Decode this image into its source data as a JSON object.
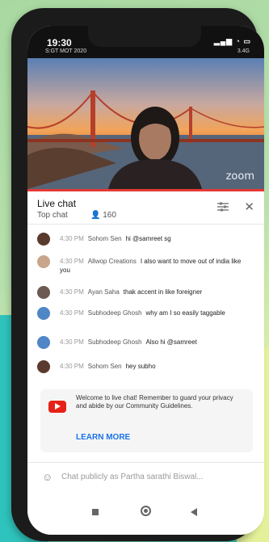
{
  "status_bar": {
    "time": "19:30",
    "sub_left": "S:GT MOT 2020",
    "sub_right": "3.4G"
  },
  "video": {
    "watermark": "zoom"
  },
  "chat_header": {
    "title": "Live chat",
    "mode": "Top chat",
    "viewer_count": "160"
  },
  "messages": [
    {
      "time": "4:30 PM",
      "name": "Sohom Sen",
      "text": "hi @samreet sg",
      "avatar_color": "#5a3a2e"
    },
    {
      "time": "4:30 PM",
      "name": "Allwop Creations",
      "text": "I also want to move out of india like you",
      "avatar_color": "#c9a58c"
    },
    {
      "time": "4:30 PM",
      "name": "Ayan Saha",
      "text": "thak accent in like foreigner",
      "avatar_color": "#6d5a52"
    },
    {
      "time": "4:30 PM",
      "name": "Subhodeep Ghosh",
      "text": "why am I so easily taggable",
      "avatar_color": "#4f86c6"
    },
    {
      "time": "4:30 PM",
      "name": "Subhodeep Ghosh",
      "text": "Also hi @samreet",
      "avatar_color": "#4f86c6"
    },
    {
      "time": "4:30 PM",
      "name": "Sohom Sen",
      "text": "hey subho",
      "avatar_color": "#5a3a2e"
    }
  ],
  "welcome": {
    "text": "Welcome to live chat! Remember to guard your privacy and abide by our Community Guidelines.",
    "learn_more": "LEARN MORE"
  },
  "input": {
    "placeholder": "Chat publicly as Partha sarathi Biswal..."
  },
  "colors": {
    "accent_red": "#e53935",
    "link_blue": "#1a73e8"
  }
}
